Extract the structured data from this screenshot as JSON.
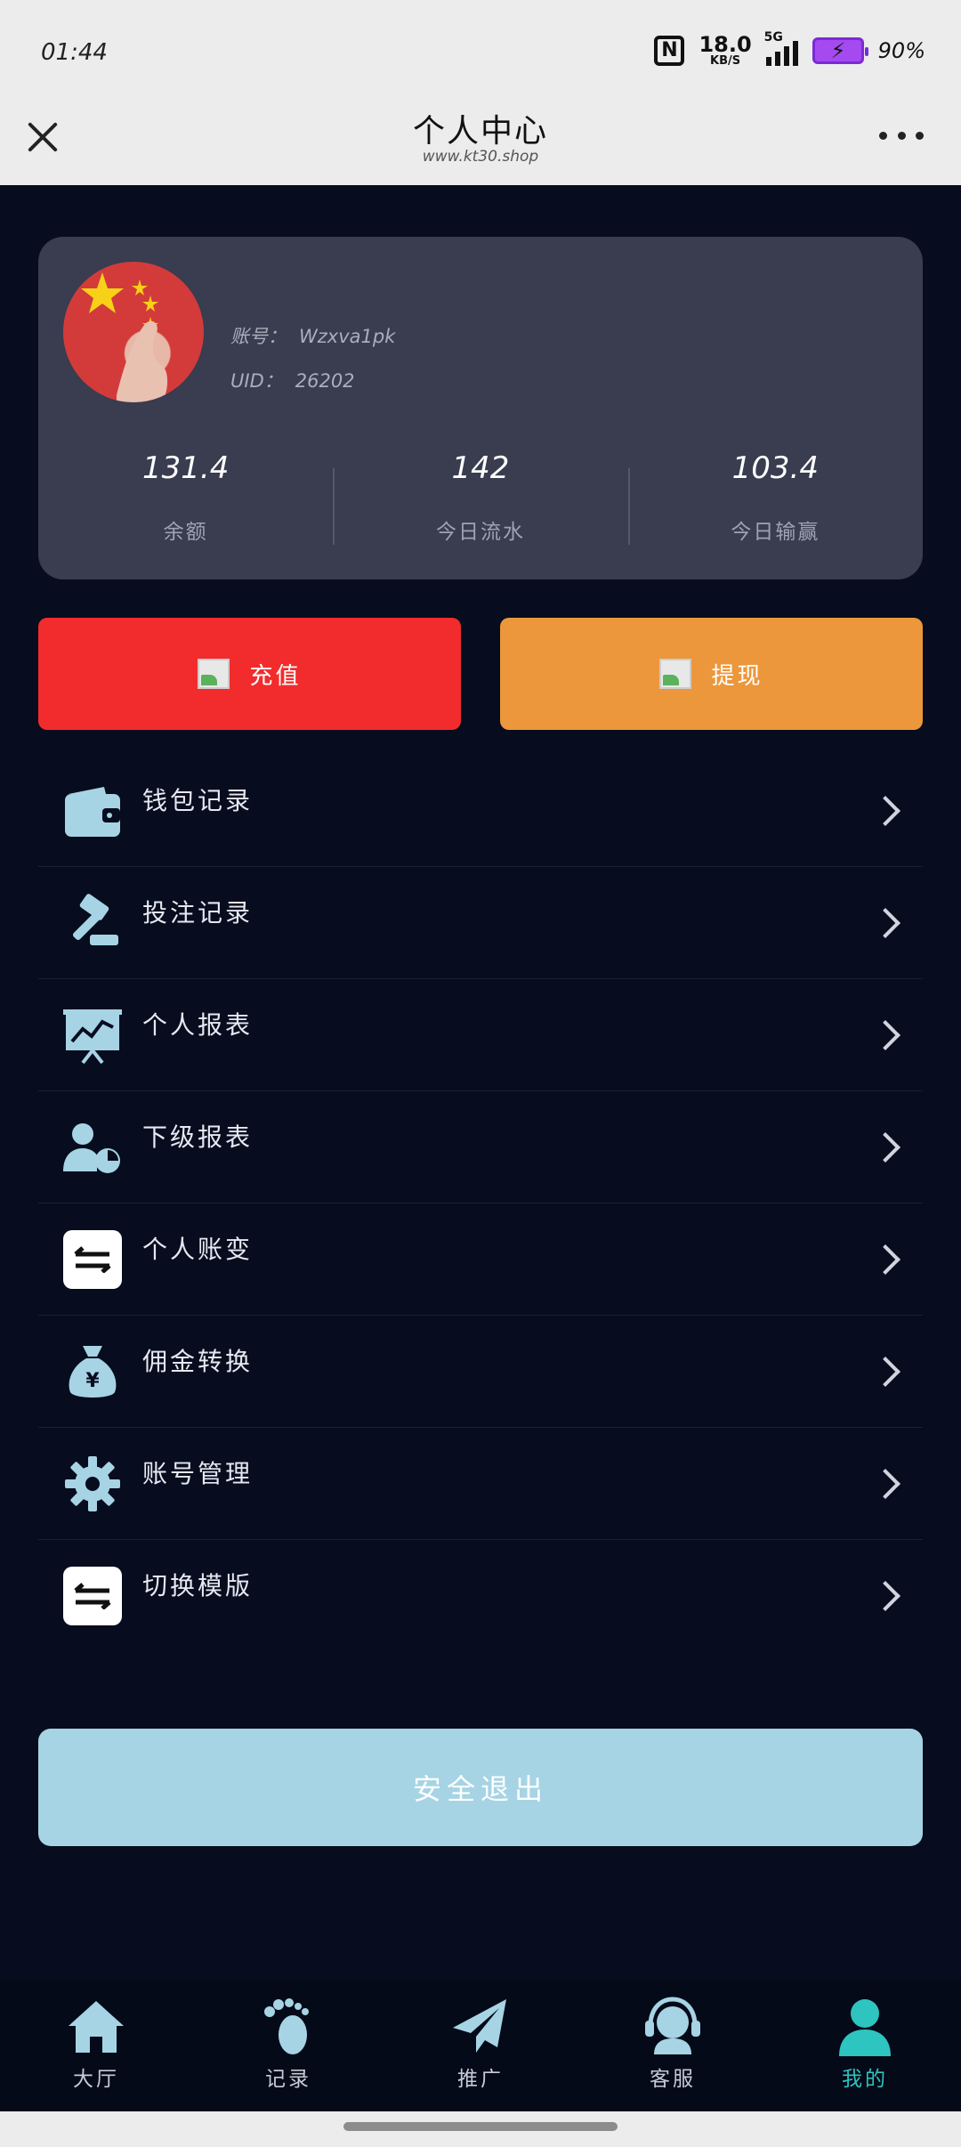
{
  "status_bar": {
    "time": "01:44",
    "net_speed_value": "18.0",
    "net_speed_unit": "KB/S",
    "network": "5G",
    "battery": "90%",
    "battery_color": "#a44af0"
  },
  "header": {
    "title": "个人中心",
    "subtitle": "www.kt30.shop"
  },
  "profile": {
    "account_label": "账号：",
    "account_value": "Wzxva1pk",
    "uid_label": "UID：",
    "uid_value": "26202",
    "stats": [
      {
        "value": "131.4",
        "label": "余额"
      },
      {
        "value": "142",
        "label": "今日流水"
      },
      {
        "value": "103.4",
        "label": "今日输赢"
      }
    ]
  },
  "actions": {
    "recharge": "充值",
    "withdraw": "提现",
    "recharge_color": "#f22c2c",
    "withdraw_color": "#ec973b"
  },
  "menu": [
    {
      "label": "钱包记录",
      "icon": "wallet-icon"
    },
    {
      "label": "投注记录",
      "icon": "gavel-icon"
    },
    {
      "label": "个人报表",
      "icon": "chart-board-icon"
    },
    {
      "label": "下级报表",
      "icon": "user-pie-icon"
    },
    {
      "label": "个人账变",
      "icon": "swap-icon"
    },
    {
      "label": "佣金转换",
      "icon": "money-bag-icon"
    },
    {
      "label": "账号管理",
      "icon": "gear-icon"
    },
    {
      "label": "切换模版",
      "icon": "swap-icon"
    }
  ],
  "logout": "安全退出",
  "bottom_nav": [
    {
      "label": "大厅",
      "icon": "home-icon"
    },
    {
      "label": "记录",
      "icon": "footprint-icon"
    },
    {
      "label": "推广",
      "icon": "paper-plane-icon"
    },
    {
      "label": "客服",
      "icon": "headset-icon"
    },
    {
      "label": "我的",
      "icon": "user-icon",
      "active": true
    }
  ],
  "colors": {
    "background": "#070c1e",
    "card": "#3a3c4f",
    "icon_blue": "#a6d4e4",
    "active_tab": "#2ec4c0"
  }
}
